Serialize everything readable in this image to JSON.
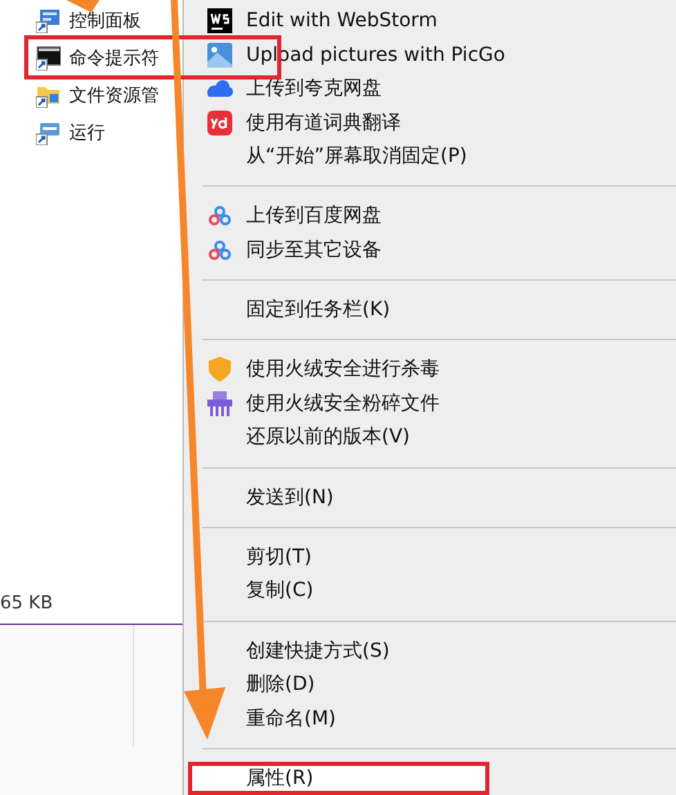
{
  "start_list": [
    {
      "label": "控制面板",
      "highlighted": false
    },
    {
      "label": "命令提示符",
      "highlighted": true
    },
    {
      "label": "文件资源管",
      "highlighted": false
    },
    {
      "label": "运行",
      "highlighted": false
    }
  ],
  "status_bar": {
    "size": "65 KB"
  },
  "context_menu": [
    {
      "kind": "item",
      "label": "Edit with WebStorm",
      "highlighted": false
    },
    {
      "kind": "item",
      "label": "Upload pictures with PicGo",
      "highlighted": false
    },
    {
      "kind": "item",
      "label": "上传到夸克网盘",
      "highlighted": false
    },
    {
      "kind": "item",
      "label": "使用有道词典翻译",
      "highlighted": false
    },
    {
      "kind": "item",
      "label": "从“开始”屏幕取消固定(P)",
      "highlighted": false
    },
    {
      "kind": "separator"
    },
    {
      "kind": "item",
      "label": "上传到百度网盘",
      "highlighted": false
    },
    {
      "kind": "item",
      "label": "同步至其它设备",
      "highlighted": false
    },
    {
      "kind": "separator"
    },
    {
      "kind": "item",
      "label": "固定到任务栏(K)",
      "highlighted": false
    },
    {
      "kind": "separator"
    },
    {
      "kind": "item",
      "label": "使用火绒安全进行杀毒",
      "highlighted": false
    },
    {
      "kind": "item",
      "label": "使用火绒安全粉碎文件",
      "highlighted": false
    },
    {
      "kind": "item",
      "label": "还原以前的版本(V)",
      "highlighted": false
    },
    {
      "kind": "separator"
    },
    {
      "kind": "item",
      "label": "发送到(N)",
      "highlighted": false
    },
    {
      "kind": "separator"
    },
    {
      "kind": "item",
      "label": "剪切(T)",
      "highlighted": false
    },
    {
      "kind": "item",
      "label": "复制(C)",
      "highlighted": false
    },
    {
      "kind": "separator"
    },
    {
      "kind": "item",
      "label": "创建快捷方式(S)",
      "highlighted": false
    },
    {
      "kind": "item",
      "label": "删除(D)",
      "highlighted": false
    },
    {
      "kind": "item",
      "label": "重命名(M)",
      "highlighted": false
    },
    {
      "kind": "separator"
    },
    {
      "kind": "item",
      "label": "属性(R)",
      "highlighted": true
    }
  ]
}
